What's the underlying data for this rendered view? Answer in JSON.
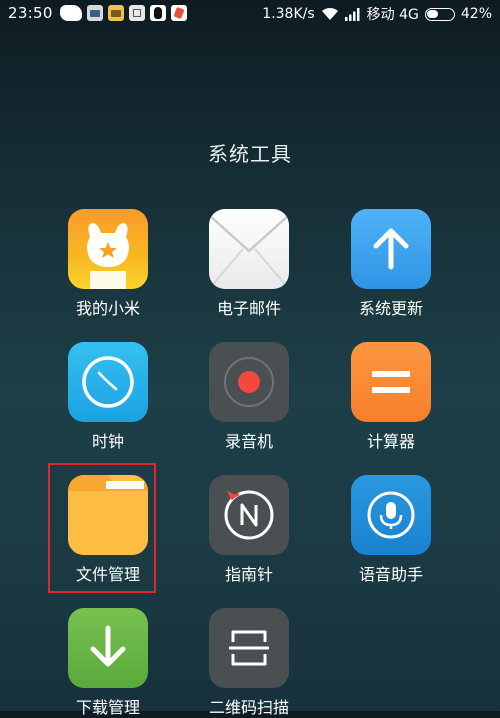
{
  "status_bar": {
    "time": "23:50",
    "speed": "1.38K/s",
    "carrier": "移动 4G",
    "battery": "42%"
  },
  "folder": {
    "title": "系统工具"
  },
  "apps": [
    {
      "label": "我的小米",
      "icon": "mi-bunny-icon",
      "color": "#f9a825"
    },
    {
      "label": "电子邮件",
      "icon": "mail-envelope-icon",
      "color": "#f2f2f2"
    },
    {
      "label": "系统更新",
      "icon": "up-arrow-icon",
      "color": "#42a5f5"
    },
    {
      "label": "时钟",
      "icon": "clock-icon",
      "color": "#29b6f6"
    },
    {
      "label": "录音机",
      "icon": "record-icon",
      "color": "#4a4f52"
    },
    {
      "label": "计算器",
      "icon": "equals-icon",
      "color": "#fb8c3a"
    },
    {
      "label": "文件管理",
      "icon": "folder-icon",
      "color": "#fdbd42"
    },
    {
      "label": "指南针",
      "icon": "compass-icon",
      "color": "#4a4f52"
    },
    {
      "label": "语音助手",
      "icon": "microphone-icon",
      "color": "#1f8fd8"
    },
    {
      "label": "下载管理",
      "icon": "download-icon",
      "color": "#66bb45"
    },
    {
      "label": "二维码扫描",
      "icon": "scan-icon",
      "color": "#4a4f52"
    }
  ],
  "highlight_color": "#e5262b"
}
